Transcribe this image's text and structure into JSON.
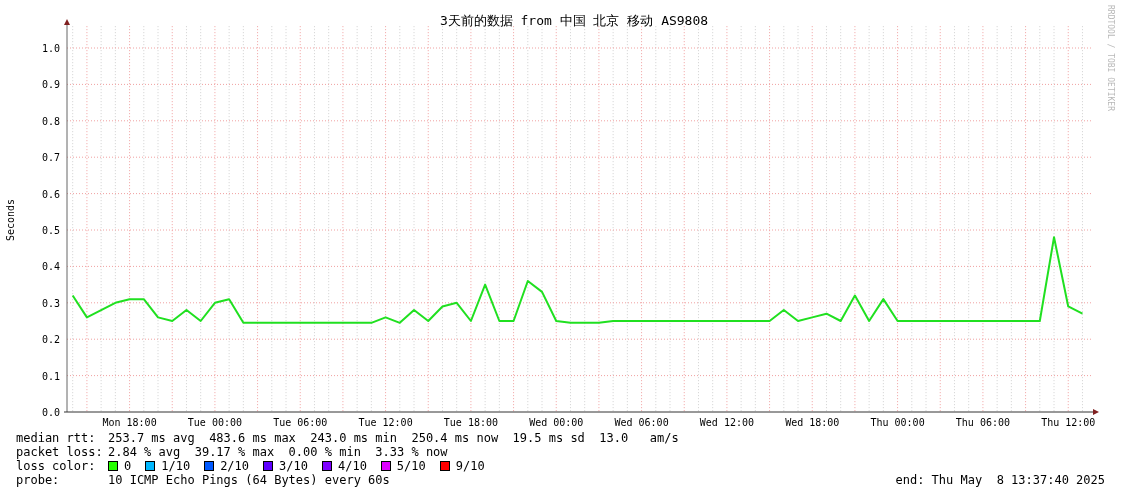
{
  "graph": {
    "title": "3天前的数据 from 中国 北京 移动 AS9808",
    "credit": "RRDTOOL / TOBI OETIKER",
    "chart_data": {
      "type": "line",
      "ylabel": "Seconds",
      "ylim": [
        0,
        1.06
      ],
      "grid": true,
      "yticks": [
        {
          "value": 0,
          "label": "0.0"
        },
        {
          "value": 0.1,
          "label": "0.1"
        },
        {
          "value": 0.2,
          "label": "0.2"
        },
        {
          "value": 0.3,
          "label": "0.3"
        },
        {
          "value": 0.4,
          "label": "0.4"
        },
        {
          "value": 0.5,
          "label": "0.5"
        },
        {
          "value": 0.6,
          "label": "0.6"
        },
        {
          "value": 0.7,
          "label": "0.7"
        },
        {
          "value": 0.8,
          "label": "0.8"
        },
        {
          "value": 0.9,
          "label": "0.9"
        },
        {
          "value": 1.0,
          "label": "1.0"
        }
      ],
      "categories": [
        null,
        null,
        null,
        null,
        "Mon 18:00",
        null,
        null,
        null,
        null,
        null,
        "Tue 00:00",
        null,
        null,
        null,
        null,
        null,
        "Tue 06:00",
        null,
        null,
        null,
        null,
        null,
        "Tue 12:00",
        null,
        null,
        null,
        null,
        null,
        "Tue 18:00",
        null,
        null,
        null,
        null,
        null,
        "Wed 00:00",
        null,
        null,
        null,
        null,
        null,
        "Wed 06:00",
        null,
        null,
        null,
        null,
        null,
        "Wed 12:00",
        null,
        null,
        null,
        null,
        null,
        "Wed 18:00",
        null,
        null,
        null,
        null,
        null,
        "Thu 00:00",
        null,
        null,
        null,
        null,
        null,
        "Thu 06:00",
        null,
        null,
        null,
        null,
        null,
        "Thu 12:00",
        null
      ],
      "series": [
        {
          "color": "#20e020",
          "values": [
            0.32,
            0.26,
            0.28,
            0.3,
            0.31,
            0.31,
            0.26,
            0.25,
            0.28,
            0.25,
            0.3,
            0.31,
            0.245,
            0.245,
            0.245,
            0.245,
            0.245,
            0.245,
            0.245,
            0.245,
            0.245,
            0.245,
            0.26,
            0.245,
            0.28,
            0.25,
            0.29,
            0.3,
            0.25,
            0.35,
            0.25,
            0.25,
            0.36,
            0.33,
            0.25,
            0.245,
            0.245,
            0.245,
            0.25,
            0.25,
            0.25,
            0.25,
            0.25,
            0.25,
            0.25,
            0.25,
            0.25,
            0.25,
            0.25,
            0.25,
            0.28,
            0.25,
            0.26,
            0.27,
            0.25,
            0.32,
            0.25,
            0.31,
            0.25,
            0.25,
            0.25,
            0.25,
            0.25,
            0.25,
            0.25,
            0.25,
            0.25,
            0.25,
            0.25,
            0.48,
            0.29,
            0.27
          ]
        }
      ]
    }
  },
  "legend": [
    {
      "kind": "text",
      "label": "median rtt:",
      "text": "253.7 ms avg  483.6 ms max  243.0 ms min  250.4 ms now  19.5 ms sd  13.0   am/s"
    },
    {
      "kind": "text",
      "label": "packet loss:",
      "text": "2.84 % avg  39.17 % max  0.00 % min  3.33 % now"
    },
    {
      "kind": "swatches",
      "label": "loss color:",
      "items": [
        {
          "text": "0",
          "color": "#26ff00"
        },
        {
          "text": "1/10",
          "color": "#00b8ff"
        },
        {
          "text": "2/10",
          "color": "#0059ff"
        },
        {
          "text": "3/10",
          "color": "#5e00ff"
        },
        {
          "text": "4/10",
          "color": "#7e00ff"
        },
        {
          "text": "5/10",
          "color": "#dd00ff"
        },
        {
          "text": "9/10",
          "color": "#ff0000"
        }
      ]
    },
    {
      "kind": "text",
      "label": "probe:",
      "text": "10 ICMP Echo Pings (64 Bytes) every 60s",
      "end": "end: Thu May  8 13:37:40 2025"
    }
  ]
}
